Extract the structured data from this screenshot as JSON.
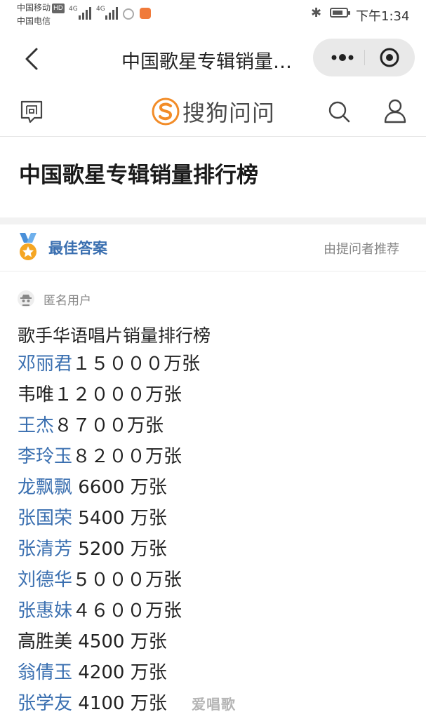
{
  "status_bar": {
    "carrier1": "中国移动",
    "carrier1_badge": "HD",
    "carrier2": "中国电信",
    "signal1": "4G",
    "signal2": "4G",
    "time": "下午1:34"
  },
  "nav": {
    "title": "中国歌星专辑销量…"
  },
  "header": {
    "logo_text": "搜狗问问"
  },
  "question": {
    "title": "中国歌星专辑销量排行榜"
  },
  "best_answer": {
    "label": "最佳答案",
    "recommended_by": "由提问者推荐"
  },
  "answer": {
    "author": "匿名用户",
    "heading": "歌手华语唱片销量排行榜",
    "items": [
      {
        "singer": "邓丽君",
        "sales": "１５０００万张",
        "linked": true
      },
      {
        "singer": "韦唯",
        "sales": "１２０００万张",
        "linked": false
      },
      {
        "singer": "王杰",
        "sales": "８７００万张",
        "linked": true
      },
      {
        "singer": "李玲玉",
        "sales": "８２００万张",
        "linked": true
      },
      {
        "singer": "龙飘飘",
        "sales": " 6600 万张",
        "linked": true
      },
      {
        "singer": "张国荣",
        "sales": " 5400 万张",
        "linked": true
      },
      {
        "singer": "张清芳",
        "sales": " 5200 万张",
        "linked": true
      },
      {
        "singer": "刘德华",
        "sales": "５０００万张",
        "linked": true
      },
      {
        "singer": "张惠妹",
        "sales": "４６００万张",
        "linked": true
      },
      {
        "singer": "高胜美",
        "sales": " 4500 万张",
        "linked": false
      },
      {
        "singer": "翁倩玉",
        "sales": " 4200 万张",
        "linked": true
      },
      {
        "singer": "张学友",
        "sales": " 4100 万张",
        "linked": true
      }
    ]
  },
  "watermark": "爱唱歌",
  "colors": {
    "link": "#3a6fb0",
    "logo_orange": "#f28c28",
    "medal_gold": "#f5a623",
    "medal_ribbon": "#4a90d9"
  }
}
